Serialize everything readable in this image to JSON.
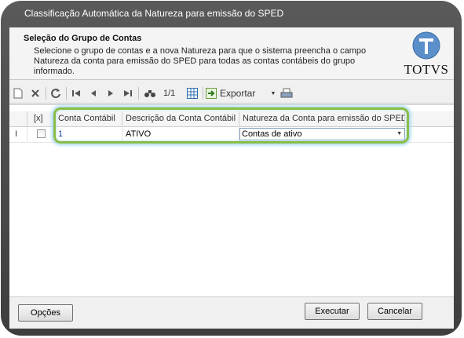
{
  "window": {
    "title": "Classificação Automática da Natureza para emissão do SPED"
  },
  "header": {
    "title": "Seleção do Grupo de Contas",
    "description": "Selecione o grupo de contas e a nova Natureza para que o sistema preencha o campo Natureza da conta para emissão do SPED para todas as contas contábeis do grupo informado.",
    "logo_text": "TOTVS"
  },
  "toolbar": {
    "page_indicator": "1/1",
    "export_label": "Exportar"
  },
  "grid": {
    "columns": [
      "[x]",
      "Conta Contábil",
      "Descrição da Conta Contábil",
      "Natureza da Conta para emissão do SPED"
    ],
    "rows": [
      {
        "indicator": "I",
        "checked": false,
        "conta": "1",
        "descricao": "ATIVO",
        "natureza": "Contas de ativo"
      }
    ]
  },
  "footer": {
    "options_label": "Opções",
    "execute_label": "Executar",
    "cancel_label": "Cancelar"
  },
  "colors": {
    "highlight_border": "#8bbd46",
    "highlight_glow": "#9fd7ee",
    "frame": "#4a4a4a"
  }
}
